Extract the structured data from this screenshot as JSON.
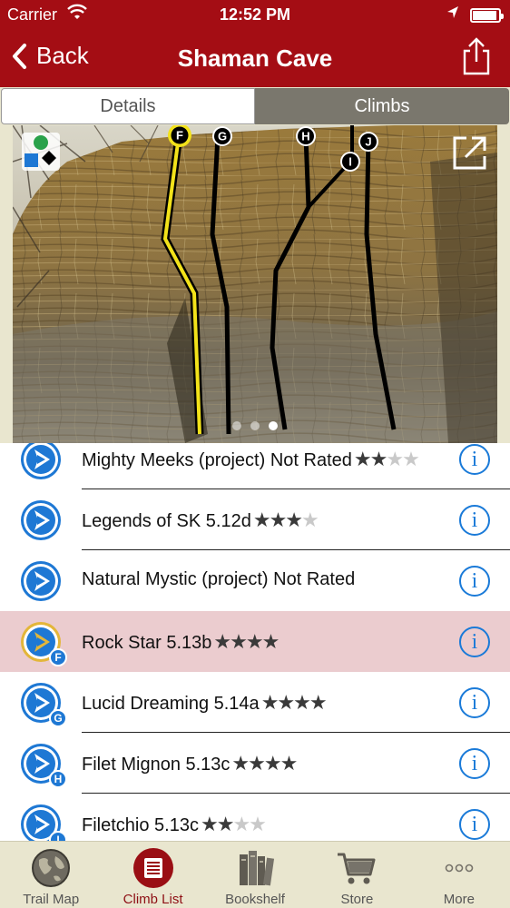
{
  "status_bar": {
    "carrier": "Carrier",
    "time": "12:52 PM"
  },
  "nav": {
    "back_label": "Back",
    "title": "Shaman Cave"
  },
  "segments": {
    "details": "Details",
    "climbs": "Climbs",
    "selected": "Climbs"
  },
  "photo": {
    "route_markers": [
      "F",
      "G",
      "H",
      "I",
      "J"
    ],
    "highlighted_route": "F",
    "page_dots": 3,
    "active_dot": 2
  },
  "climbs": [
    {
      "name": "Mighty Meeks (project)  Not Rated",
      "stars": 2,
      "max_stars": 4,
      "badge": "",
      "selected": false
    },
    {
      "name": "Legends of SK 5.12d",
      "stars": 3,
      "max_stars": 4,
      "badge": "",
      "selected": false
    },
    {
      "name": "Natural Mystic (project) Not Rated",
      "stars": 0,
      "max_stars": 0,
      "badge": "",
      "selected": false
    },
    {
      "name": "Rock Star 5.13b",
      "stars": 4,
      "max_stars": 4,
      "badge": "F",
      "selected": true
    },
    {
      "name": "Lucid Dreaming 5.14a",
      "stars": 4,
      "max_stars": 4,
      "badge": "G",
      "selected": false
    },
    {
      "name": "Filet Mignon 5.13c",
      "stars": 4,
      "max_stars": 4,
      "badge": "H",
      "selected": false
    },
    {
      "name": "Filetchio 5.13c",
      "stars": 2,
      "max_stars": 4,
      "badge": "I",
      "selected": false
    }
  ],
  "tabs": [
    {
      "label": "Trail Map",
      "icon": "globe-icon"
    },
    {
      "label": "Climb List",
      "icon": "list-icon",
      "active": true
    },
    {
      "label": "Bookshelf",
      "icon": "books-icon"
    },
    {
      "label": "Store",
      "icon": "cart-icon"
    },
    {
      "label": "More",
      "icon": "more-icon"
    }
  ],
  "colors": {
    "nav_red": "#a40d14",
    "accent_blue": "#1a7ad8",
    "selected_row": "#ebcccf",
    "route_highlight": "#f2e21a"
  }
}
